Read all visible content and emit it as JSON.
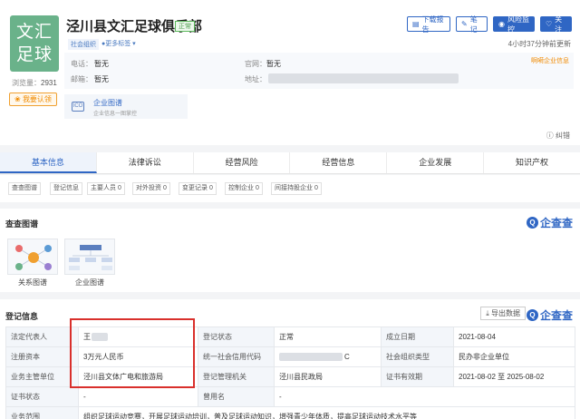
{
  "company": {
    "logo_text": "文汇足球",
    "name": "泾川县文汇足球俱乐部",
    "status_badge": "正常",
    "tags": [
      "社会组织"
    ],
    "more_tags": "●更多标签 ▾",
    "views_label": "浏览量：",
    "views": "2931",
    "claim_button": "我要认领",
    "phone_label": "电话：",
    "phone": "暂无",
    "email_label": "邮箱：",
    "email": "暂无",
    "website_label": "官网：",
    "website": "暂无",
    "address_label": "地址："
  },
  "actions": {
    "download_report": "下载报告",
    "notes": "笔记",
    "risk_monitor": "风险监控",
    "follow": "关注"
  },
  "updated_text": "4小时37分钟前更新",
  "watermark": "啊嗬企业信息",
  "enterprise_card": {
    "title": "企业图谱",
    "subtitle": "企业信息一图掌控"
  },
  "feedback": "纠错",
  "tabs": [
    "基本信息",
    "法律诉讼",
    "经营风险",
    "经营信息",
    "企业发展",
    "知识产权"
  ],
  "active_tab": 0,
  "subtabs": [
    "查查图谱",
    "登记信息",
    "主要人员 0",
    "对外投资 0",
    "变更记录 0",
    "控制企业 0",
    "间接持股企业 0"
  ],
  "graph_section": {
    "title": "查查图谱",
    "brand": "企查查",
    "items": [
      "关系图谱",
      "企业图谱"
    ]
  },
  "registration": {
    "title": "登记信息",
    "export_label": "导出数据",
    "brand": "企查查",
    "rows": [
      [
        {
          "k": "法定代表人",
          "v": "王"
        },
        {
          "k": "登记状态",
          "v": "正常"
        },
        {
          "k": "成立日期",
          "v": "2021-08-04"
        }
      ],
      [
        {
          "k": "注册资本",
          "v": "3万元人民币"
        },
        {
          "k": "统一社会信用代码",
          "v": "C"
        },
        {
          "k": "社会组织类型",
          "v": "民办非企业单位"
        }
      ],
      [
        {
          "k": "业务主管单位",
          "v": "泾川县文体广电和旅游局"
        },
        {
          "k": "登记管理机关",
          "v": "泾川县民政局"
        },
        {
          "k": "证书有效期",
          "v": "2021-08-02 至 2025-08-02"
        }
      ],
      [
        {
          "k": "证书状态",
          "v": "-"
        },
        {
          "k": "曾用名",
          "v": "-"
        }
      ],
      [
        {
          "k": "业务范围",
          "v": "组织足球运动竞赛，开展足球运动培训，普及足球运动知识，增强青少年体质，提高足球运动技术水平等"
        }
      ]
    ]
  },
  "colors": {
    "accent": "#2f66c4",
    "logo_bg": "#6ab28a",
    "highlight_box": "#d9302c",
    "status_green": "#4a9d4a",
    "orange": "#f08a00"
  }
}
